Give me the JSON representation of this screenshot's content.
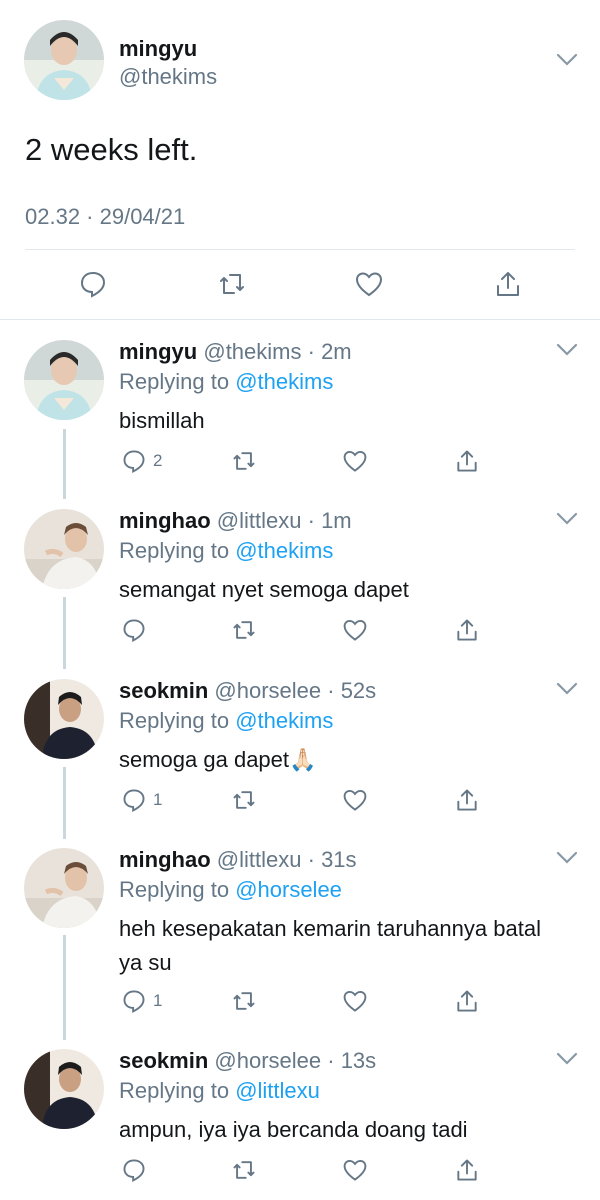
{
  "main_tweet": {
    "display_name": "mingyu",
    "handle": "@thekims",
    "text": "2 weeks left.",
    "timestamp": "02.32 · 29/04/21",
    "icons": [
      "reply-icon",
      "retweet-icon",
      "like-icon",
      "share-icon"
    ]
  },
  "replies": [
    {
      "display_name": "mingyu",
      "handle": "@thekims",
      "time": "· 2m",
      "replying_prefix": "Replying to ",
      "replying_to": "@thekims",
      "text": "bismillah",
      "reply_count": "2"
    },
    {
      "display_name": "minghao",
      "handle": "@littlexu",
      "time": "· 1m",
      "replying_prefix": "Replying to ",
      "replying_to": "@thekims",
      "text": "semangat nyet semoga dapet",
      "reply_count": ""
    },
    {
      "display_name": "seokmin",
      "handle": "@horselee",
      "time": "· 52s",
      "replying_prefix": "Replying to ",
      "replying_to": "@thekims",
      "text": "semoga ga dapet🙏🏻",
      "reply_count": "1"
    },
    {
      "display_name": "minghao",
      "handle": "@littlexu",
      "time": "· 31s",
      "replying_prefix": "Replying to ",
      "replying_to": "@horselee",
      "text": "heh kesepakatan kemarin taruhannya batal ya su",
      "reply_count": "1"
    },
    {
      "display_name": "seokmin",
      "handle": "@horselee",
      "time": "· 13s",
      "replying_prefix": "Replying to ",
      "replying_to": "@littlexu",
      "text": "ampun, iya iya bercanda doang tadi",
      "reply_count": ""
    }
  ],
  "colors": {
    "accent": "#1da1f2",
    "muted": "#657786",
    "divider": "#e1e8ed",
    "thread": "#ccd6dd"
  }
}
